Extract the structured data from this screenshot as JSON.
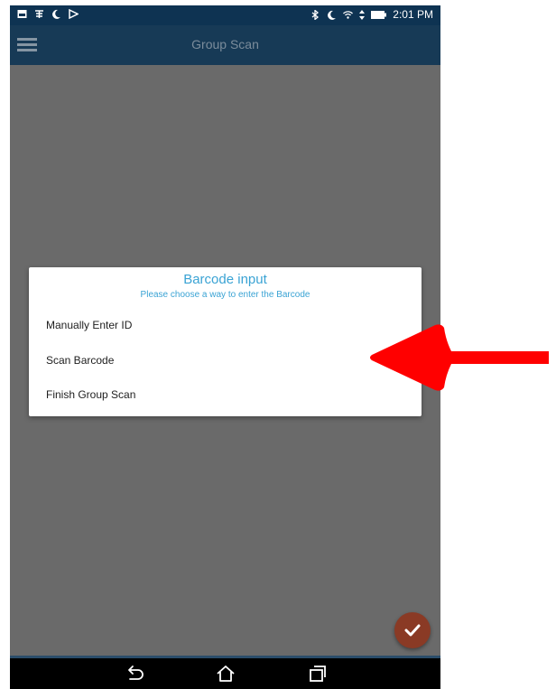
{
  "status_bar": {
    "time": "2:01 PM",
    "left_icons": [
      "image-icon",
      "translate-icon",
      "moon-icon",
      "play-store-icon"
    ],
    "right_icons": [
      "bluetooth-icon",
      "moon-icon",
      "wifi-icon",
      "data-arrows-icon",
      "battery-icon"
    ]
  },
  "app_bar": {
    "title": "Group Scan",
    "menu_icon": "hamburger-menu-icon"
  },
  "dialog": {
    "title": "Barcode input",
    "subtitle": "Please choose a way to enter the Barcode",
    "options": [
      {
        "label": "Manually Enter ID"
      },
      {
        "label": "Scan Barcode"
      },
      {
        "label": "Finish Group Scan"
      }
    ]
  },
  "fab": {
    "icon": "checkmark-icon",
    "color": "#8a3a25"
  },
  "nav_bar": {
    "buttons": [
      "back-icon",
      "home-icon",
      "recent-apps-icon"
    ]
  },
  "annotation": {
    "type": "red-arrow-icon",
    "color": "#ff0000"
  },
  "colors": {
    "primary_dark": "#0e3352",
    "accent_text": "#3aa3d4",
    "scrim": "#6a6a6a"
  }
}
